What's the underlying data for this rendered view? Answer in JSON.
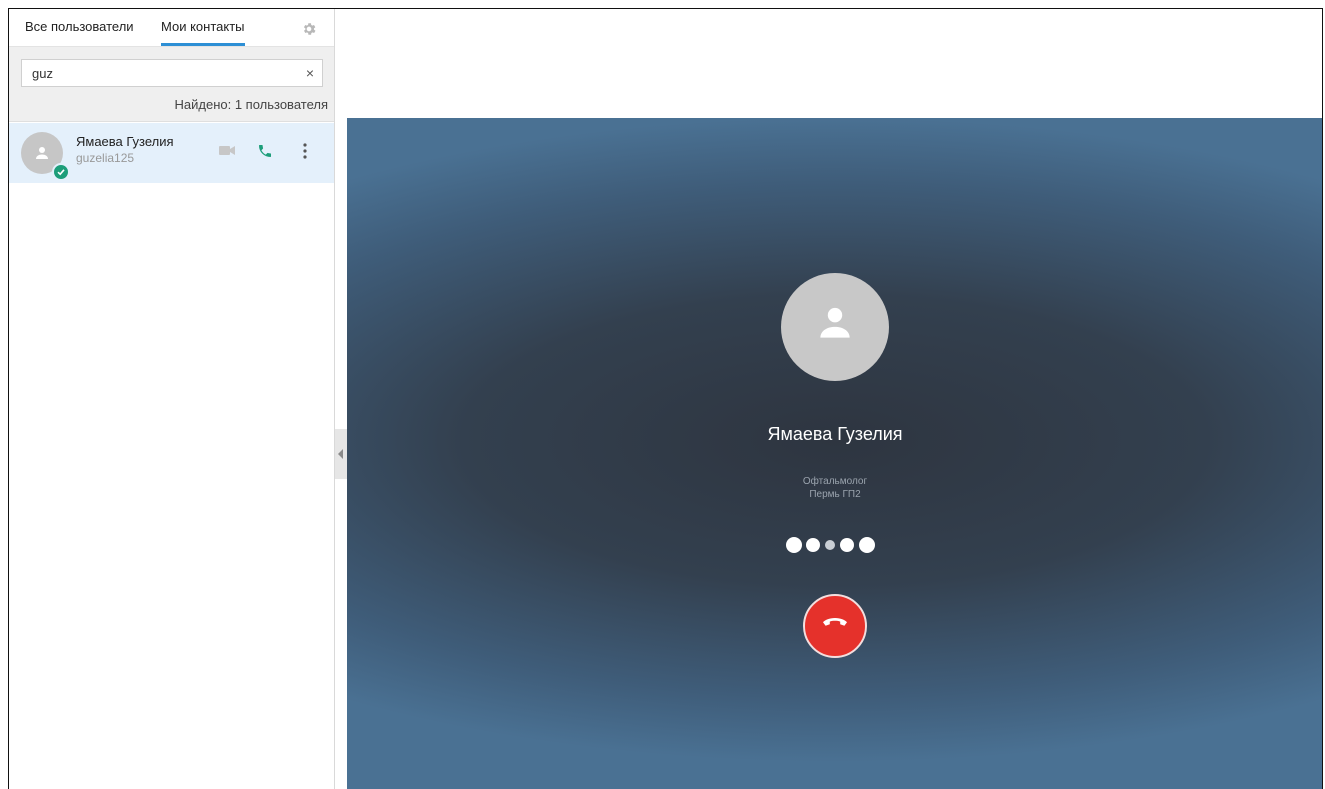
{
  "sidebar": {
    "tabs": [
      {
        "label": "Все пользователи",
        "active": false
      },
      {
        "label": "Мои контакты",
        "active": true
      }
    ],
    "settings_icon": "gear-icon",
    "search": {
      "value": "guz",
      "clear_icon": "×"
    },
    "found_text": "Найдено: 1 пользователя",
    "contacts": [
      {
        "name": "Ямаева Гузелия",
        "login": "guzelia125",
        "status": "online",
        "actions": [
          "video-call-icon",
          "phone-icon",
          "more-vertical-icon"
        ]
      }
    ]
  },
  "call": {
    "name": "Ямаева Гузелия",
    "role": "Офтальмолог",
    "organization": "Пермь ГП2",
    "hangup_icon": "hangup-icon"
  },
  "colors": {
    "accent": "#2d8fd5",
    "phone_green": "#1d9e7a",
    "hangup_red": "#e5312b",
    "selected_row": "#e4f0fb"
  }
}
